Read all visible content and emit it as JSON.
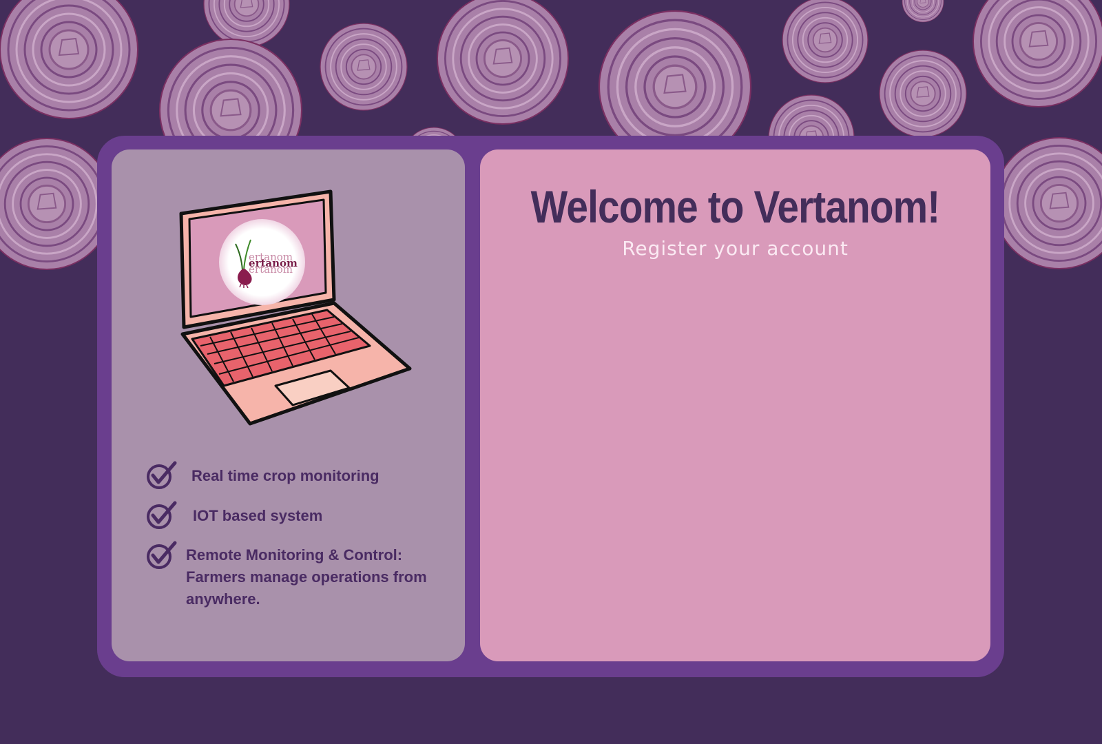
{
  "header": {
    "title": "Welcome to Vertanom!",
    "subtitle": "Register your account"
  },
  "logo": {
    "lines": [
      "ertanom",
      "ertanom",
      "ertanom"
    ]
  },
  "features": [
    {
      "label": "Real time crop monitoring"
    },
    {
      "label": "IOT based system"
    },
    {
      "label": "Remote Monitoring & Control: Farmers manage operations from anywhere."
    }
  ],
  "colors": {
    "background": "#432d5a",
    "frame": "#6a3e8e",
    "left_panel": "#a991ab",
    "right_panel": "#d99aba",
    "title": "#432d5a",
    "subtitle": "#fbeaf3",
    "onion_rings": "#a77aa6"
  },
  "icons": [
    "onion-ring-icon",
    "laptop-icon",
    "onion-logo-icon",
    "checkmark-icon"
  ]
}
